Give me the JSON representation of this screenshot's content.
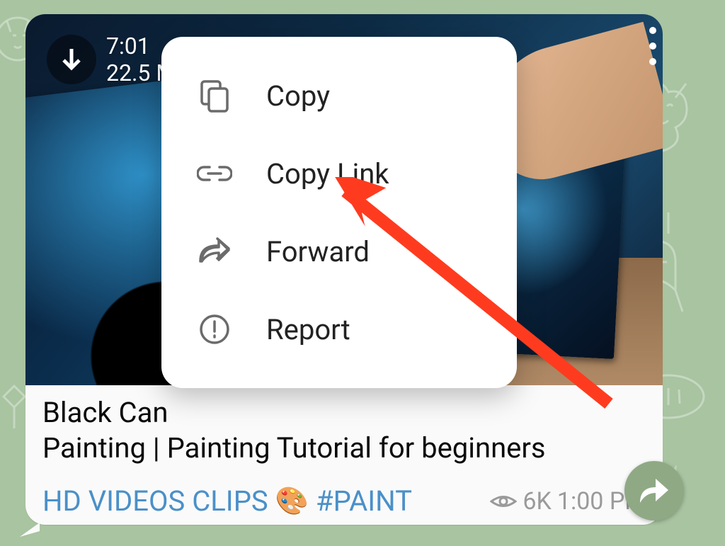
{
  "video": {
    "duration": "7:01",
    "size": "22.5 M"
  },
  "caption": {
    "title": "Black Can\nPainting | Painting Tutorial for beginners",
    "channel": "HD VIDEOS CLIPS",
    "emoji": "🎨",
    "hashtag": "#PAINT",
    "views": "6K",
    "time": "1:00 PM"
  },
  "menu": {
    "copy": "Copy",
    "copy_link": "Copy Link",
    "forward": "Forward",
    "report": "Report"
  }
}
